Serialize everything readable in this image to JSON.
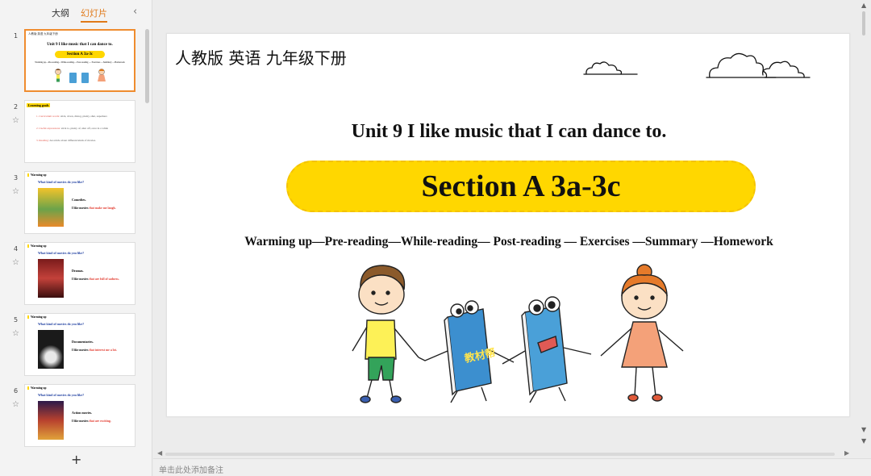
{
  "panel": {
    "tabs": [
      {
        "label": "大纲",
        "active": false
      },
      {
        "label": "幻灯片",
        "active": true
      }
    ],
    "collapse_icon": "chevron-left",
    "add_button": "+"
  },
  "thumbnails": [
    {
      "num": "1",
      "top_label": "人教版 英语 九年级下册",
      "title": "Unit 9 I like music that I can dance to.",
      "section": "Section A 3a-3c",
      "nav": "Warming up—Pre-reading—While-reading— Post-reading — Exercises —Summary —Homework"
    },
    {
      "num": "2",
      "label": "Learning goals",
      "lines": [
        {
          "label": "1. Curriculum words:",
          "text": "stick, down, dialog, plenty, shut, superhero"
        },
        {
          "label": "2. Useful expressions:",
          "text": "stick to, plenty of, shut off, once in a while"
        },
        {
          "label": "3. Reading:",
          "text": "An article about different kinds of movies."
        }
      ]
    },
    {
      "num": "3",
      "label": "Warming up",
      "question": "What kind of movies do you like?",
      "genre": "Comedies.",
      "like_prefix": "I like movies ",
      "like_red": "that make me laugh."
    },
    {
      "num": "4",
      "label": "Warming up",
      "question": "What kind of movies do you like?",
      "genre": "Dramas.",
      "like_prefix": "I like movies ",
      "like_red": "that are full of sadness."
    },
    {
      "num": "5",
      "label": "Warming up",
      "question": "What kind of movies do you like?",
      "genre": "Documentaries.",
      "like_prefix": "I like movies ",
      "like_red": "that interest me a lot."
    },
    {
      "num": "6",
      "label": "Warming up",
      "question": "What kind of movies do you like?",
      "genre": "Action movies.",
      "like_prefix": "I like movies ",
      "like_red": "that are exciting."
    }
  ],
  "slide": {
    "top_label": "人教版 英语 九年级下册",
    "title": "Unit 9 I like music that I can dance to.",
    "section": "Section A 3a-3c",
    "nav": "Warming up—Pre-reading—While-reading— Post-reading — Exercises —Summary —Homework",
    "book_label": "教材帮"
  },
  "notes": {
    "placeholder": "单击此处添加备注"
  },
  "colors": {
    "accent": "#e07a1a",
    "pill": "#ffd700",
    "highlight_red": "#e23b2f"
  }
}
